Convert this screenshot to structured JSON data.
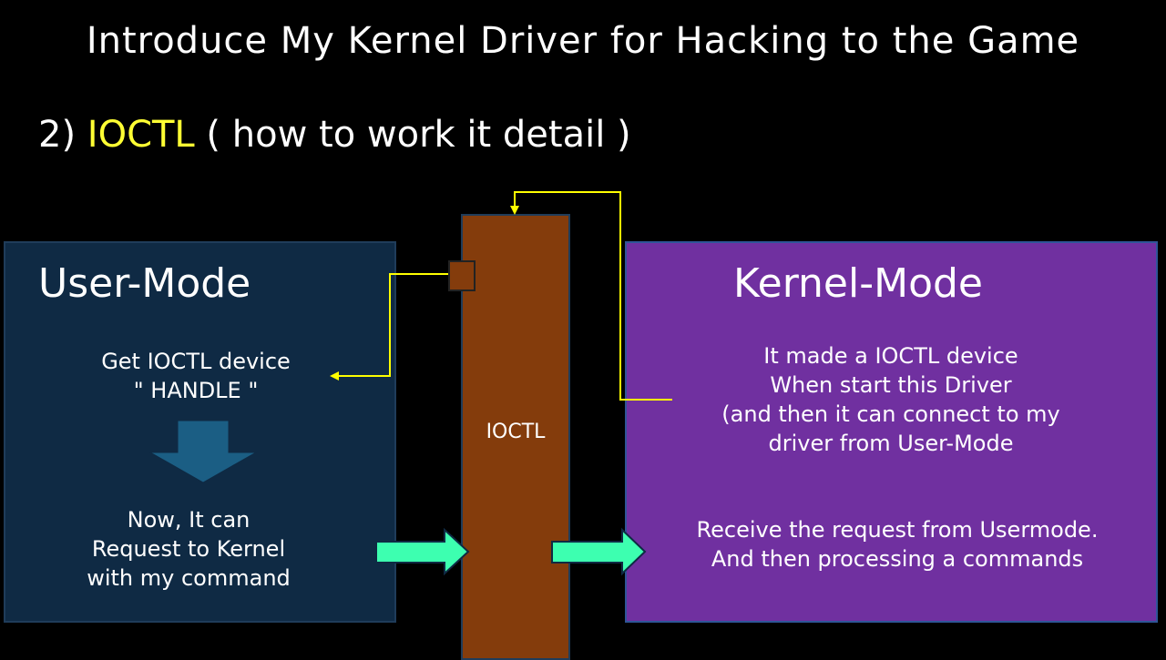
{
  "title": "Introduce My Kernel Driver for Hacking to the Game",
  "subtitle": {
    "prefix": "2) ",
    "highlight": "IOCTL",
    "suffix": " ( how to work it detail )"
  },
  "user_mode": {
    "heading": "User-Mode",
    "step1": [
      "Get IOCTL device",
      "\" HANDLE \""
    ],
    "step2": [
      "Now, It can",
      "Request to Kernel",
      "with my command"
    ]
  },
  "ioctl": {
    "label": "IOCTL"
  },
  "kernel_mode": {
    "heading": "Kernel-Mode",
    "desc": [
      "It made a IOCTL device",
      "When start this Driver",
      "(and then it can connect to my",
      "driver from User-Mode"
    ],
    "process": [
      "Receive the request from Usermode.",
      "And then processing a commands"
    ]
  },
  "colors": {
    "highlight": "#ffff33",
    "user_box": "#0f2a44",
    "kernel_box": "#7030a0",
    "ioctl_bar": "#843c0c",
    "connector": "#ffff00",
    "arrow_down": "#1b5e84",
    "arrow_right": "#3dffb0"
  }
}
